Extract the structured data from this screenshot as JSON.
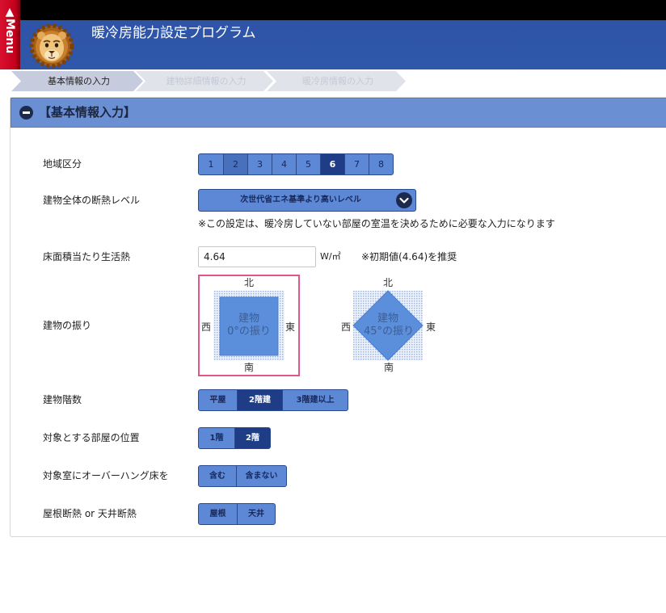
{
  "colors": {
    "topbar": "#000000",
    "header": "#2f57aa",
    "menu_tab": "#c4001c",
    "accent": "#5c88d6",
    "selected": "#1e3d86",
    "highlight": "#4870bd",
    "section_header": "#6b8fd3",
    "selection_border": "#e0558a",
    "button_border": "#2a4a8e"
  },
  "menu_tab": {
    "label": "▲Menu"
  },
  "header": {
    "title": "暖冷房能力設定プログラム",
    "logo_icon": "lion-logo"
  },
  "steps": [
    {
      "label": "基本情報の入力",
      "active": true
    },
    {
      "label": "建物詳細情報の入力",
      "active": false
    },
    {
      "label": "暖冷房情報の入力",
      "active": false
    }
  ],
  "section": {
    "title": "【基本情報入力】",
    "toggle_icon": "minus-circle-icon"
  },
  "form": {
    "region": {
      "label": "地域区分",
      "options": [
        {
          "label": "1"
        },
        {
          "label": "2",
          "highlighted": true
        },
        {
          "label": "3"
        },
        {
          "label": "4"
        },
        {
          "label": "5"
        },
        {
          "label": "6",
          "selected": true
        },
        {
          "label": "7"
        },
        {
          "label": "8"
        }
      ]
    },
    "insulation": {
      "label": "建物全体の断熱レベル",
      "value": "次世代省エネ基準より高いレベル",
      "icon": "chevron-down-icon",
      "note": "※この設定は、暖冷房していない部屋の室温を決めるために必要な入力になります"
    },
    "living_heat": {
      "label": "床面積当たり生活熱",
      "value": "4.64",
      "unit": "W/㎡",
      "note": "※初期値(4.64)を推奨"
    },
    "orientation": {
      "label": "建物の振り",
      "compass": {
        "north": "北",
        "south": "南",
        "west": "西",
        "east": "東"
      },
      "options": [
        {
          "line1": "建物",
          "line2": "0°の振り",
          "selected": true
        },
        {
          "line1": "建物",
          "line2": "45°の振り",
          "selected": false
        }
      ]
    },
    "floors": {
      "label": "建物階数",
      "options": [
        {
          "label": "平屋"
        },
        {
          "label": "2階建",
          "selected": true
        },
        {
          "label": "3階建以上"
        }
      ]
    },
    "room_position": {
      "label": "対象とする部屋の位置",
      "options": [
        {
          "label": "1階"
        },
        {
          "label": "2階",
          "selected": true
        }
      ]
    },
    "overhang": {
      "label": "対象室にオーバーハング床を",
      "options": [
        {
          "label": "含む"
        },
        {
          "label": "含まない"
        }
      ]
    },
    "roof": {
      "label": "屋根断熱 or 天井断熱",
      "options": [
        {
          "label": "屋根"
        },
        {
          "label": "天井"
        }
      ]
    }
  }
}
